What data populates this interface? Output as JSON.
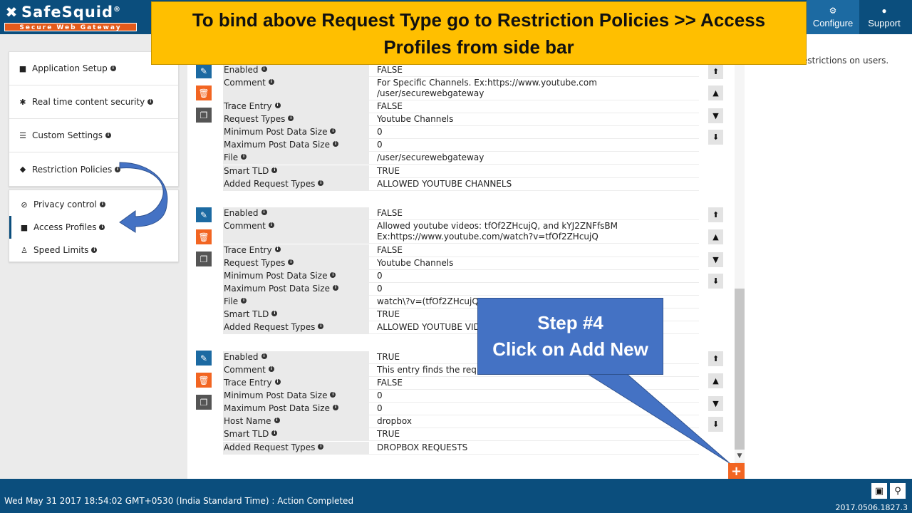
{
  "header": {
    "logo_title": "SafeSquid",
    "logo_reg": "®",
    "logo_subtitle": "Secure Web Gateway",
    "configure_label": "Configure",
    "support_label": "Support",
    "active_tab": "Configure"
  },
  "banner": {
    "text": "To bind above Request Type go to Restriction Policies >> Access Profiles from side bar",
    "background": "#ffbf00"
  },
  "sidebar": {
    "items": [
      {
        "label": "Application Setup",
        "icon": "briefcase-icon"
      },
      {
        "label": "Real time content security",
        "icon": "bug-icon"
      },
      {
        "label": "Custom Settings",
        "icon": "sliders-icon"
      },
      {
        "label": "Restriction Policies",
        "icon": "shield-icon"
      }
    ],
    "sub_items": [
      {
        "label": "Privacy control",
        "icon": "ban-icon"
      },
      {
        "label": "Access Profiles",
        "icon": "briefcase-icon",
        "active": true
      },
      {
        "label": "Speed Limits",
        "icon": "speed-icon"
      }
    ]
  },
  "right_panel": {
    "text": "... enforce restrictions on users."
  },
  "entries": [
    {
      "rows": [
        {
          "label": "Enabled",
          "value": "FALSE"
        },
        {
          "label": "Comment",
          "value": "For Specific Channels. Ex:https://www.youtube.com /user/securewebgateway"
        },
        {
          "label": "Trace Entry",
          "value": "FALSE"
        },
        {
          "label": "Request Types",
          "value": "Youtube Channels"
        },
        {
          "label": "Minimum Post Data Size",
          "value": "0"
        },
        {
          "label": "Maximum Post Data Size",
          "value": "0"
        },
        {
          "label": "File",
          "value": "/user/securewebgateway"
        },
        {
          "label": "Smart TLD",
          "value": "TRUE"
        },
        {
          "label": "Added Request Types",
          "value": "ALLOWED YOUTUBE CHANNELS"
        }
      ]
    },
    {
      "rows": [
        {
          "label": "Enabled",
          "value": "FALSE"
        },
        {
          "label": "Comment",
          "value": "Allowed youtube videos: tfOf2ZHcujQ, and kYJ2ZNFfsBM Ex:https://www.youtube.com/watch?v=tfOf2ZHcujQ"
        },
        {
          "label": "Trace Entry",
          "value": "FALSE"
        },
        {
          "label": "Request Types",
          "value": "Youtube Channels"
        },
        {
          "label": "Minimum Post Data Size",
          "value": "0"
        },
        {
          "label": "Maximum Post Data Size",
          "value": "0"
        },
        {
          "label": "File",
          "value": "watch\\?v=(tfOf2ZHcujQ"
        },
        {
          "label": "Smart TLD",
          "value": "TRUE"
        },
        {
          "label": "Added Request Types",
          "value": "ALLOWED YOUTUBE VID"
        }
      ]
    },
    {
      "rows": [
        {
          "label": "Enabled",
          "value": "TRUE"
        },
        {
          "label": "Comment",
          "value": "This entry finds the req"
        },
        {
          "label": "Trace Entry",
          "value": "FALSE"
        },
        {
          "label": "Minimum Post Data Size",
          "value": "0"
        },
        {
          "label": "Maximum Post Data Size",
          "value": "0"
        },
        {
          "label": "Host Name",
          "value": "dropbox"
        },
        {
          "label": "Smart TLD",
          "value": "TRUE"
        },
        {
          "label": "Added Request Types",
          "value": "DROPBOX REQUESTS"
        }
      ]
    }
  ],
  "callout": {
    "line1": "Step #4",
    "line2": "Click on Add New",
    "color": "#4472c4"
  },
  "footer": {
    "status": "Wed May 31 2017 18:54:02 GMT+0530 (India Standard Time) : Action Completed",
    "version": "2017.0506.1827.3"
  },
  "colors": {
    "header_bg": "#0b4e7d",
    "accent_orange": "#f26522",
    "edit_blue": "#1c6aa2"
  }
}
